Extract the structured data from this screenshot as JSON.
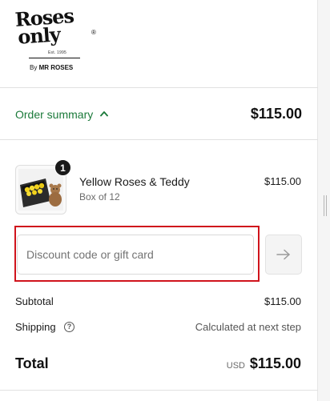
{
  "brand": {
    "logo_line1": "Roses",
    "logo_line2": "only",
    "registered": "®",
    "established": "Est. 1995",
    "byline_prefix": "By",
    "byline_brand": "MR ROSES"
  },
  "summary": {
    "toggle_label": "Order summary",
    "toggle_state": "expanded",
    "total": "$115.00",
    "accent_color": "#1b7a3a"
  },
  "line_item": {
    "quantity": "1",
    "name": "Yellow Roses & Teddy",
    "variant": "Box of 12",
    "price": "$115.00"
  },
  "discount": {
    "placeholder": "Discount code or gift card",
    "value": "",
    "apply_icon": "arrow-right-icon",
    "highlight_color": "#d0141c"
  },
  "totals": {
    "subtotal_label": "Subtotal",
    "subtotal_value": "$115.00",
    "shipping_label": "Shipping",
    "shipping_help_icon": "question-circle-icon",
    "shipping_help_glyph": "?",
    "shipping_value": "Calculated at next step",
    "total_label": "Total",
    "currency": "USD",
    "total_value": "$115.00"
  }
}
